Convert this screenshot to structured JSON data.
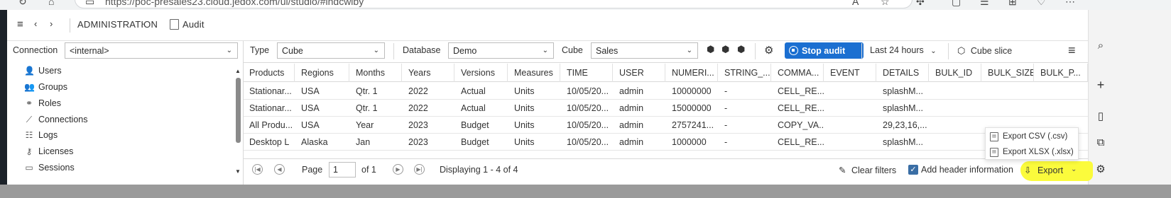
{
  "browser": {
    "url": "https://poc-presales23.cloud.jedox.com/ui/studio/#indcwiby",
    "edge_sidebar_icons": [
      "search-icon",
      "add-icon",
      "split-screen-icon",
      "open-external-icon",
      "settings-icon"
    ]
  },
  "header": {
    "breadcrumb": [
      "ADMINISTRATION",
      "Audit"
    ],
    "separator": "›"
  },
  "connection": {
    "label": "Connection",
    "value": "<internal>"
  },
  "sidebar": {
    "items": [
      {
        "label": "Users",
        "icon": "user-icon"
      },
      {
        "label": "Groups",
        "icon": "group-icon"
      },
      {
        "label": "Roles",
        "icon": "roles-icon"
      },
      {
        "label": "Connections",
        "icon": "connections-icon"
      },
      {
        "label": "Logs",
        "icon": "logs-icon"
      },
      {
        "label": "Licenses",
        "icon": "key-icon"
      },
      {
        "label": "Sessions",
        "icon": "sessions-icon"
      }
    ]
  },
  "toolbar": {
    "type_label": "Type",
    "type_value": "Cube",
    "database_label": "Database",
    "database_value": "Demo",
    "cube_label": "Cube",
    "cube_value": "Sales",
    "stop_audit": "Stop audit",
    "time_range": "Last 24 hours",
    "cube_slice": "Cube slice"
  },
  "grid": {
    "columns": [
      "Products",
      "Regions",
      "Months",
      "Years",
      "Versions",
      "Measures",
      "TIME",
      "USER",
      "NUMERI...",
      "STRING_...",
      "COMMA...",
      "EVENT",
      "DETAILS",
      "BULK_ID",
      "BULK_SIZE",
      "BULK_P..."
    ],
    "rows": [
      [
        "Stationar...",
        "USA",
        "Qtr. 1",
        "2022",
        "Actual",
        "Units",
        "10/05/20...",
        "admin",
        "10000000",
        "-",
        "CELL_RE...",
        "",
        "splashM...",
        "",
        "",
        ""
      ],
      [
        "Stationar...",
        "USA",
        "Qtr. 1",
        "2022",
        "Actual",
        "Units",
        "10/05/20...",
        "admin",
        "15000000",
        "-",
        "CELL_RE...",
        "",
        "splashM...",
        "",
        "",
        ""
      ],
      [
        "All Produ...",
        "USA",
        "Year",
        "2023",
        "Budget",
        "Units",
        "10/05/20...",
        "admin",
        "2757241...",
        "-",
        "COPY_VA...",
        "",
        "29,23,16,...",
        "",
        "",
        ""
      ],
      [
        "Desktop L",
        "Alaska",
        "Jan",
        "2023",
        "Budget",
        "Units",
        "10/05/20...",
        "admin",
        "1000000",
        "-",
        "CELL_RE...",
        "",
        "splashM...",
        "",
        "",
        ""
      ]
    ]
  },
  "pager": {
    "page_label": "Page",
    "page_value": "1",
    "of_label": "of 1",
    "displaying": "Displaying 1 - 4 of 4",
    "clear_filters": "Clear filters",
    "add_header_info": "Add header information",
    "export": "Export"
  },
  "export_menu": {
    "items": [
      "Export CSV (.csv)",
      "Export XLSX (.xlsx)"
    ]
  },
  "colors": {
    "accent": "#1b6fd1",
    "highlight": "#fbfb3c",
    "checkbox": "#3a6ea5"
  }
}
